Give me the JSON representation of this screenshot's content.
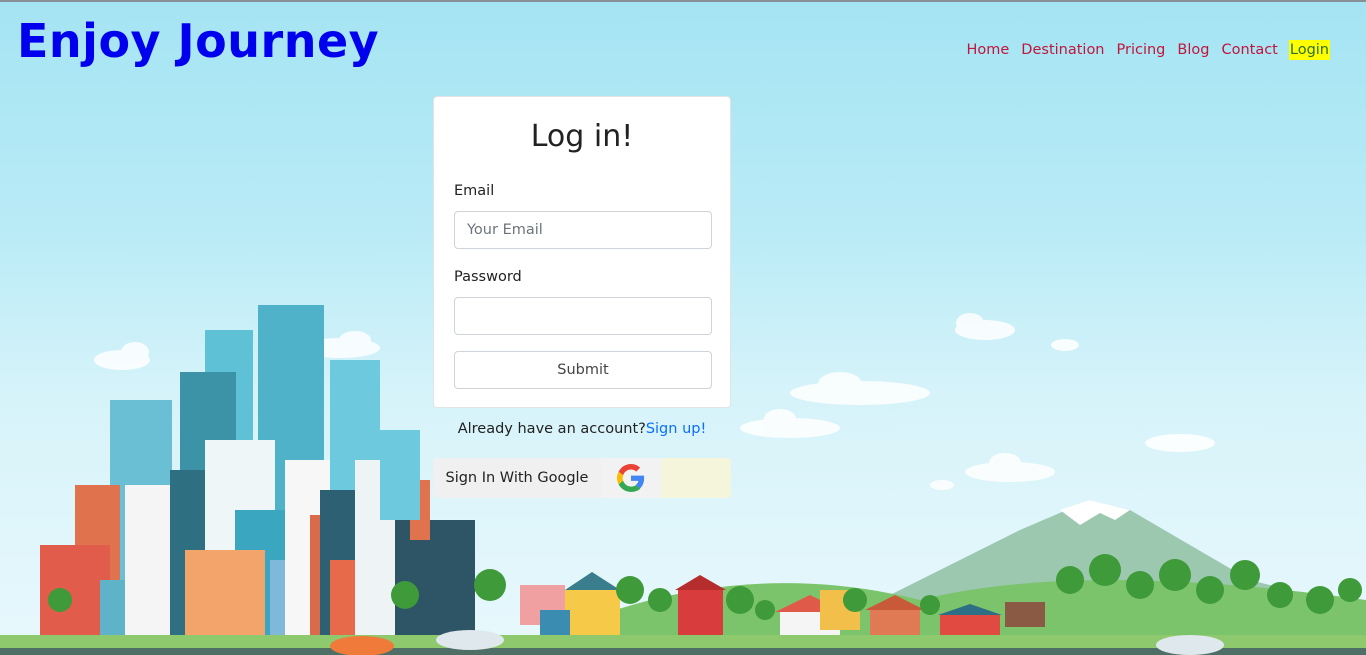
{
  "header": {
    "logo": "Enjoy Journey",
    "nav": [
      {
        "label": "Home",
        "active": false
      },
      {
        "label": "Destination",
        "active": false
      },
      {
        "label": "Pricing",
        "active": false
      },
      {
        "label": "Blog",
        "active": false
      },
      {
        "label": "Contact",
        "active": false
      },
      {
        "label": "Login",
        "active": true
      }
    ]
  },
  "login": {
    "title": "Log in!",
    "email_label": "Email",
    "email_placeholder": "Your Email",
    "email_value": "",
    "password_label": "Password",
    "password_value": "",
    "submit_label": "Submit"
  },
  "signup": {
    "prompt": "Already have an account?",
    "link": "Sign up!"
  },
  "google": {
    "label": "Sign In With Google",
    "icon": "google-g-icon"
  },
  "colors": {
    "logo": "#0000ee",
    "nav_link": "#c0163c",
    "nav_active_bg": "#ffff00",
    "link": "#0d6efd"
  }
}
